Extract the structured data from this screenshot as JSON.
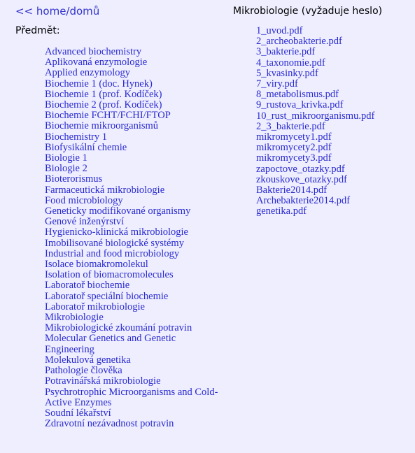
{
  "page": {
    "background_color": "#eeeeff",
    "link_color": "#2a2ad0",
    "heading_color": "#000000"
  },
  "left_column": {
    "home_link": "<< home/domů",
    "section_title": "Předmět:",
    "subjects": [
      "Advanced biochemistry",
      "Aplikovaná enzymologie",
      "Applied enzymology",
      "Biochemie 1 (doc. Hynek)",
      "Biochemie 1 (prof. Kodíček)",
      "Biochemie 2 (prof. Kodíček)",
      "Biochemie FCHT/FCHI/FTOP",
      "Biochemie mikroorganismů",
      "Biochemistry 1",
      "Biofysikální chemie",
      "Biologie 1",
      "Biologie 2",
      "Bioterorismus",
      "Farmaceutická mikrobiologie",
      "Food microbiology",
      "Geneticky modifikované organismy",
      "Genové inženýrství",
      "Hygienicko-klinická mikrobiologie",
      "Imobilisované biologické systémy",
      "Industrial and food microbiology",
      "Isolace biomakromolekul",
      "Isolation of biomacromolecules",
      "Laboratoř biochemie",
      "Laboratoř speciální biochemie",
      "Laboratoř mikrobiologie",
      "Mikrobiologie",
      "Mikrobiologické zkoumání potravin",
      "Molecular Genetics and Genetic Engineering",
      "Molekulová genetika",
      "Pathologie člověka",
      "Potravinářská mikrobiologie",
      "Psychrotrophic Microorganisms and Cold-Active Enzymes",
      "Soudní lékařství",
      "Zdravotní nezávadnost potravin"
    ]
  },
  "right_column": {
    "section_title": "Mikrobiologie (vyžaduje heslo)",
    "files": [
      "1_uvod.pdf",
      "2_archeobakterie.pdf",
      "3_bakterie.pdf",
      "4_taxonomie.pdf",
      "5_kvasinky.pdf",
      "7_viry.pdf",
      "8_metabolismus.pdf",
      "9_rustova_krivka.pdf",
      "10_rust_mikroorganismu.pdf",
      "2_3_bakterie.pdf",
      "mikromycety1.pdf",
      "mikromycety2.pdf",
      "mikromycety3.pdf",
      "zapoctove_otazky.pdf",
      "zkouskove_otazky.pdf",
      "Bakterie2014.pdf",
      "Archebakterie2014.pdf",
      "genetika.pdf"
    ]
  }
}
